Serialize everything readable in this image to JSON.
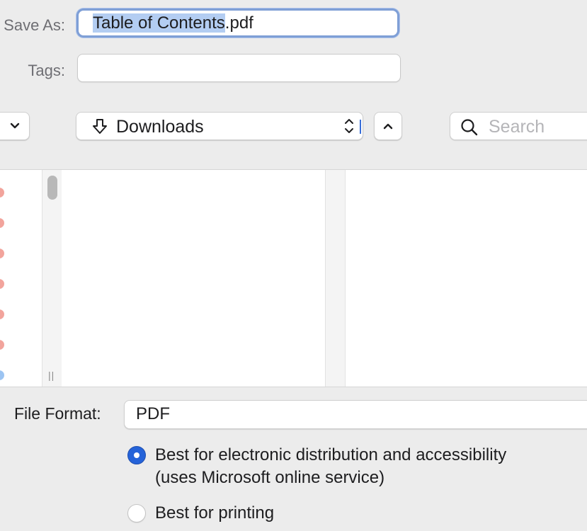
{
  "save_as": {
    "label": "Save As:",
    "value_selected": "Table of Contents",
    "value_rest": ".pdf"
  },
  "tags": {
    "label": "Tags:",
    "value": ""
  },
  "toolbar": {
    "view_icon": "chevron-down-icon",
    "location_icon": "download-arrow-icon",
    "location_value": "Downloads",
    "location_chooser_icon": "up-down-chevron-icon",
    "up_icon": "chevron-up-icon",
    "search_icon": "magnifier-icon",
    "search_placeholder": "Search"
  },
  "browser": {
    "sidebar_dot_colors": [
      "#f2a49c",
      "#f2a49c",
      "#f2a49c",
      "#f2a49c",
      "#f2a49c",
      "#f2a49c",
      "#9cc4f2"
    ],
    "resize_handle": "||"
  },
  "file_format": {
    "label": "File Format:",
    "value": "PDF"
  },
  "options": {
    "option_1_line1": "Best for electronic distribution and accessibility",
    "option_1_line2": "(uses Microsoft online service)",
    "option_1_selected": true,
    "option_2": "Best for printing",
    "option_2_selected": false
  },
  "colors": {
    "accent": "#2563d9",
    "focus_ring": "#7f9fd6",
    "selection": "#b3cdf2"
  }
}
